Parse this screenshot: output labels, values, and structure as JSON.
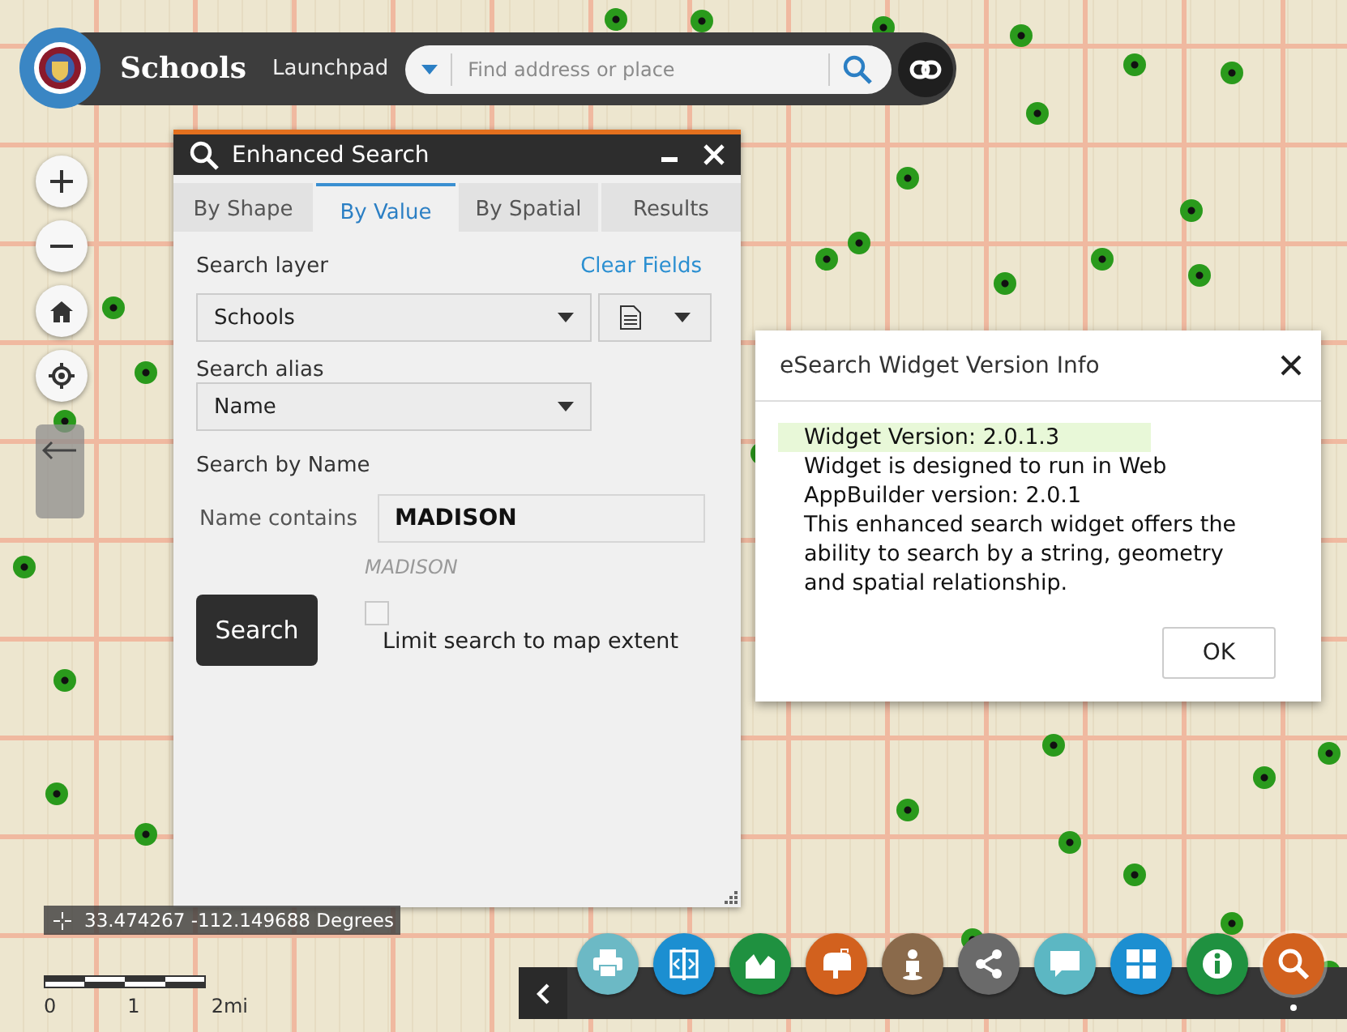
{
  "header": {
    "title": "Schools",
    "launchpad": "Launchpad",
    "search_placeholder": "Find address or place"
  },
  "panel": {
    "title": "Enhanced Search",
    "tabs": [
      {
        "label": "By Shape",
        "selected": false
      },
      {
        "label": "By Value",
        "selected": true
      },
      {
        "label": "By Spatial",
        "selected": false
      },
      {
        "label": "Results",
        "selected": false
      }
    ],
    "search_layer_label": "Search layer",
    "clear_fields": "Clear Fields",
    "layer_select": "Schools",
    "alias_label": "Search alias",
    "alias_select": "Name",
    "search_by": "Search by Name",
    "field_label": "Name contains",
    "field_value": "MADISON",
    "hint": "MADISON",
    "search_button": "Search",
    "limit": {
      "label": "Limit search to map extent",
      "checked": false
    }
  },
  "dialog": {
    "title": "eSearch Widget Version Info",
    "paragraphs": [
      {
        "text": "Widget Version: 2.0.1.3",
        "highlighted": true
      },
      {
        "text": "Widget is designed to run in Web AppBuilder version: 2.0.1",
        "highlighted": false
      },
      {
        "text": "This enhanced search widget offers the ability to search by a string, geometry and spatial relationship.",
        "highlighted": false
      }
    ],
    "ok_button": "OK"
  },
  "coordinates": "33.474267 -112.149688 Degrees",
  "scale_labels": [
    "0",
    "1",
    "2mi"
  ],
  "toolbar": [
    {
      "kind": "print",
      "color": "#6cb9c5",
      "selected": false
    },
    {
      "kind": "swipe",
      "color": "#1c8fd1",
      "selected": false
    },
    {
      "kind": "chart",
      "color": "#1f9140",
      "selected": false
    },
    {
      "kind": "mailbox",
      "color": "#d2611e",
      "selected": false
    },
    {
      "kind": "person",
      "color": "#8a6a4b",
      "selected": false
    },
    {
      "kind": "share",
      "color": "#6a6a6a",
      "selected": false
    },
    {
      "kind": "comment",
      "color": "#5cb7c3",
      "selected": false
    },
    {
      "kind": "grid",
      "color": "#1c8fd1",
      "selected": false
    },
    {
      "kind": "info",
      "color": "#1f9140",
      "selected": false
    },
    {
      "kind": "search",
      "color": "#d2611e",
      "selected": true
    }
  ]
}
